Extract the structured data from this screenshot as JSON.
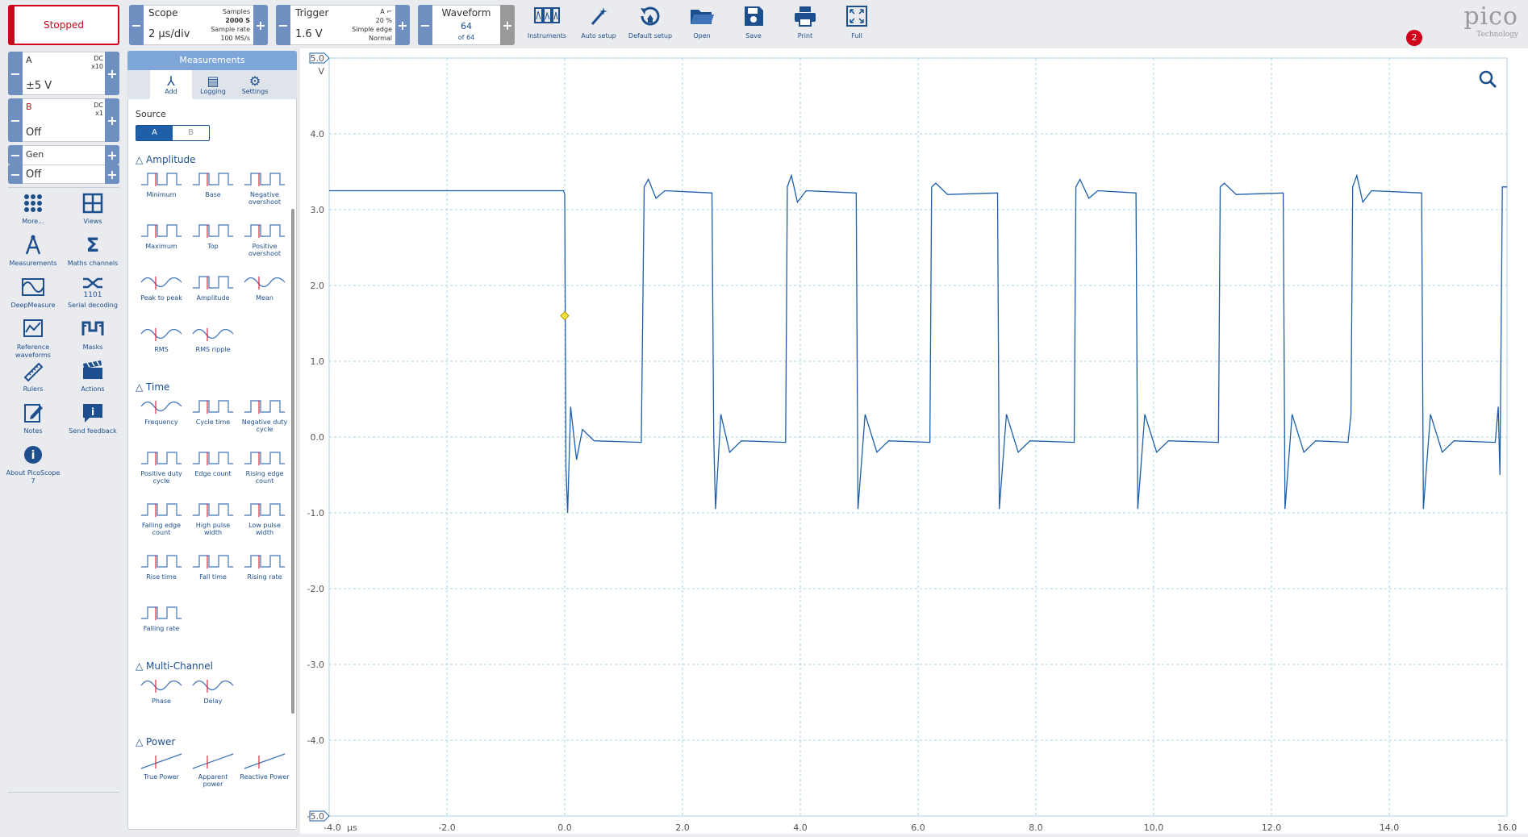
{
  "toolbar": {
    "run_label": "Stopped",
    "scope": {
      "title": "Scope",
      "timebase": "2 µs/div",
      "samples_label": "Samples",
      "samples": "2000 S",
      "rate_label": "Sample rate",
      "rate": "100 MS/s"
    },
    "trigger": {
      "title": "Trigger",
      "level": "1.6 V",
      "channel": "A",
      "pretrigger": "20 %",
      "type": "Simple edge",
      "mode": "Normal"
    },
    "waveform": {
      "title": "Waveform",
      "current": "64",
      "total": "of 64"
    },
    "tools": [
      {
        "label": "Instruments",
        "icon": "instruments-icon"
      },
      {
        "label": "Auto setup",
        "icon": "wand-icon"
      },
      {
        "label": "Default setup",
        "icon": "reset-icon"
      },
      {
        "label": "Open",
        "icon": "folder-icon"
      },
      {
        "label": "Save",
        "icon": "save-icon"
      },
      {
        "label": "Print",
        "icon": "print-icon"
      },
      {
        "label": "Full",
        "icon": "fullscreen-icon"
      }
    ],
    "logo_text": "pico",
    "logo_sub": "Technology",
    "notifications": "2"
  },
  "channels": [
    {
      "name": "A",
      "coupling": "DC",
      "probe": "x10",
      "range": "±5 V",
      "color": "#1d5fa8"
    },
    {
      "name": "B",
      "coupling": "DC",
      "probe": "x1",
      "range": "Off",
      "color": "#d0021b"
    },
    {
      "name": "Gen",
      "coupling": "",
      "probe": "",
      "range": "Off",
      "color": "#333333"
    }
  ],
  "sidebar": [
    {
      "label": "More...",
      "icon": "more-icon"
    },
    {
      "label": "Views",
      "icon": "views-icon"
    },
    {
      "label": "Measurements",
      "icon": "measurements-icon"
    },
    {
      "label": "Maths channels",
      "icon": "sigma-icon"
    },
    {
      "label": "DeepMeasure",
      "icon": "deepmeasure-icon"
    },
    {
      "label": "Serial decoding",
      "icon": "serial-icon"
    },
    {
      "label": "Reference waveforms",
      "icon": "reference-icon"
    },
    {
      "label": "Masks",
      "icon": "masks-icon"
    },
    {
      "label": "Rulers",
      "icon": "ruler-icon"
    },
    {
      "label": "Actions",
      "icon": "actions-icon"
    },
    {
      "label": "Notes",
      "icon": "notes-icon"
    },
    {
      "label": "Send feedback",
      "icon": "feedback-icon"
    },
    {
      "label": "About PicoScope 7",
      "icon": "info-icon"
    }
  ],
  "measurements": {
    "title": "Measurements",
    "tabs": [
      "Add",
      "Logging",
      "Settings"
    ],
    "source_label": "Source",
    "sources": [
      "A",
      "B"
    ],
    "sections": [
      {
        "title": "Amplitude",
        "items": [
          "Minimum",
          "Base",
          "Negative overshoot",
          "Maximum",
          "Top",
          "Positive overshoot",
          "Peak to peak",
          "Amplitude",
          "Mean",
          "RMS",
          "RMS ripple"
        ]
      },
      {
        "title": "Time",
        "items": [
          "Frequency",
          "Cycle time",
          "Negative duty cycle",
          "Positive duty cycle",
          "Edge count",
          "Rising edge count",
          "Falling edge count",
          "High pulse width",
          "Low pulse width",
          "Rise time",
          "Fall time",
          "Rising rate",
          "Falling rate"
        ]
      },
      {
        "title": "Multi-Channel",
        "items": [
          "Phase",
          "Delay"
        ]
      },
      {
        "title": "Power",
        "items": [
          "True Power",
          "Apparent power",
          "Reactive Power"
        ]
      }
    ]
  },
  "chart_data": {
    "type": "line",
    "y_unit": "V",
    "x_unit": "µs",
    "xlim": [
      -4.0,
      16.0
    ],
    "ylim": [
      -5.0,
      5.0
    ],
    "x_ticks": [
      "-4.0",
      "-2.0",
      "0.0",
      "2.0",
      "4.0",
      "6.0",
      "8.0",
      "10.0",
      "12.0",
      "14.0",
      "16.0"
    ],
    "y_ticks": [
      "5.0",
      "4.0",
      "3.0",
      "2.0",
      "1.0",
      "0.0",
      "-1.0",
      "-2.0",
      "-3.0",
      "-4.0",
      "-5.0"
    ],
    "trigger_point": {
      "x": 0.0,
      "y": 1.6
    },
    "series": [
      {
        "color": "#1d5fa8",
        "points": [
          [
            -4.0,
            3.25
          ],
          [
            -0.02,
            3.25
          ],
          [
            0.0,
            3.2
          ],
          [
            0.02,
            -0.4
          ],
          [
            0.05,
            -1.0
          ],
          [
            0.1,
            0.4
          ],
          [
            0.2,
            -0.3
          ],
          [
            0.3,
            0.1
          ],
          [
            0.5,
            -0.05
          ],
          [
            1.3,
            -0.07
          ],
          [
            1.35,
            3.3
          ],
          [
            1.42,
            3.4
          ],
          [
            1.55,
            3.15
          ],
          [
            1.7,
            3.25
          ],
          [
            2.5,
            3.22
          ],
          [
            2.53,
            0.0
          ],
          [
            2.56,
            -0.95
          ],
          [
            2.65,
            0.3
          ],
          [
            2.8,
            -0.2
          ],
          [
            3.0,
            -0.05
          ],
          [
            3.75,
            -0.07
          ],
          [
            3.78,
            3.3
          ],
          [
            3.85,
            3.45
          ],
          [
            3.95,
            3.1
          ],
          [
            4.1,
            3.25
          ],
          [
            4.95,
            3.22
          ],
          [
            4.98,
            -0.95
          ],
          [
            5.1,
            0.3
          ],
          [
            5.3,
            -0.2
          ],
          [
            5.5,
            -0.05
          ],
          [
            6.2,
            -0.07
          ],
          [
            6.23,
            3.3
          ],
          [
            6.3,
            3.35
          ],
          [
            6.5,
            3.2
          ],
          [
            7.35,
            3.22
          ],
          [
            7.38,
            -0.95
          ],
          [
            7.5,
            0.3
          ],
          [
            7.7,
            -0.2
          ],
          [
            7.9,
            -0.05
          ],
          [
            8.65,
            -0.07
          ],
          [
            8.68,
            3.3
          ],
          [
            8.75,
            3.4
          ],
          [
            8.9,
            3.15
          ],
          [
            9.05,
            3.25
          ],
          [
            9.7,
            3.22
          ],
          [
            9.73,
            -0.95
          ],
          [
            9.85,
            0.3
          ],
          [
            10.05,
            -0.2
          ],
          [
            10.25,
            -0.05
          ],
          [
            11.1,
            -0.07
          ],
          [
            11.13,
            3.3
          ],
          [
            11.2,
            3.35
          ],
          [
            11.4,
            3.2
          ],
          [
            12.2,
            3.22
          ],
          [
            12.23,
            -0.95
          ],
          [
            12.35,
            0.3
          ],
          [
            12.55,
            -0.2
          ],
          [
            12.75,
            -0.05
          ],
          [
            13.3,
            -0.07
          ],
          [
            13.35,
            0.3
          ],
          [
            13.38,
            3.3
          ],
          [
            13.45,
            3.45
          ],
          [
            13.55,
            3.1
          ],
          [
            13.7,
            3.25
          ],
          [
            14.55,
            3.22
          ],
          [
            14.58,
            -0.95
          ],
          [
            14.7,
            0.3
          ],
          [
            14.9,
            -0.2
          ],
          [
            15.1,
            -0.05
          ],
          [
            15.8,
            -0.07
          ],
          [
            15.85,
            0.4
          ],
          [
            15.88,
            -0.5
          ],
          [
            15.92,
            3.3
          ],
          [
            16.0,
            3.3
          ]
        ]
      }
    ]
  }
}
